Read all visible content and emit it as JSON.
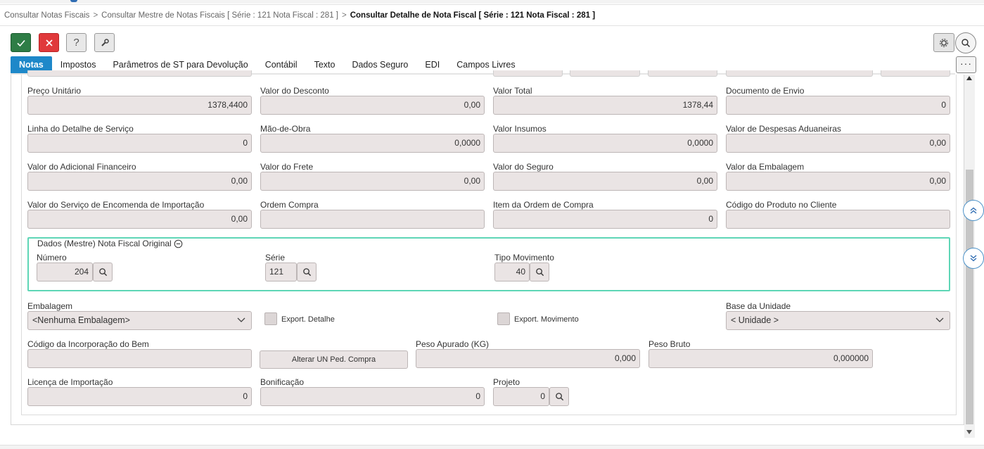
{
  "breadcrumb": {
    "item1": "Consultar Notas Fiscais",
    "separator": ">",
    "item2": "Consultar Mestre de Notas Fiscais [ Série : 121 Nota Fiscal : 281 ]",
    "current": "Consultar Detalhe de Nota Fiscal [ Série : 121 Nota Fiscal : 281 ]"
  },
  "toolbar": {
    "confirm_icon": "check-icon",
    "cancel_icon": "close-icon",
    "help_label": "?",
    "tool_icon": "wrench-icon",
    "gear_icon": "gear-icon",
    "search_icon": "search-icon",
    "more_label": "···"
  },
  "tabs": [
    {
      "label": "Notas",
      "active": true
    },
    {
      "label": "Impostos"
    },
    {
      "label": "Parâmetros de ST para Devolução"
    },
    {
      "label": "Contábil"
    },
    {
      "label": "Texto"
    },
    {
      "label": "Dados Seguro"
    },
    {
      "label": "EDI"
    },
    {
      "label": "Campos Livres"
    }
  ],
  "fields": {
    "preco_unitario": {
      "label": "Preço Unitário",
      "value": "1378,4400"
    },
    "valor_desconto": {
      "label": "Valor do Desconto",
      "value": "0,00"
    },
    "valor_total": {
      "label": "Valor Total",
      "value": "1378,44"
    },
    "documento_envio": {
      "label": "Documento de Envio",
      "value": "0"
    },
    "linha_detalhe_servico": {
      "label": "Linha do Detalhe de Serviço",
      "value": "0"
    },
    "mao_de_obra": {
      "label": "Mão-de-Obra",
      "value": "0,0000"
    },
    "valor_insumos": {
      "label": "Valor Insumos",
      "value": "0,0000"
    },
    "valor_despesas_aduaneiras": {
      "label": "Valor de Despesas Aduaneiras",
      "value": "0,00"
    },
    "valor_adicional_financeiro": {
      "label": "Valor do Adicional Financeiro",
      "value": "0,00"
    },
    "valor_frete": {
      "label": "Valor do Frete",
      "value": "0,00"
    },
    "valor_seguro": {
      "label": "Valor do Seguro",
      "value": "0,00"
    },
    "valor_embalagem": {
      "label": "Valor da Embalagem",
      "value": "0,00"
    },
    "valor_servico_encomenda": {
      "label": "Valor do Serviço de Encomenda de Importação",
      "value": "0,00"
    },
    "ordem_compra": {
      "label": "Ordem Compra",
      "value": ""
    },
    "item_ordem_compra": {
      "label": "Item da Ordem de Compra",
      "value": "0"
    },
    "codigo_produto_cliente": {
      "label": "Código do Produto no Cliente",
      "value": ""
    },
    "codigo_incorporacao_bem": {
      "label": "Código da Incorporação do Bem",
      "value": ""
    },
    "peso_apurado": {
      "label": "Peso Apurado (KG)",
      "value": "0,000"
    },
    "peso_bruto": {
      "label": "Peso Bruto",
      "value": "0,000000"
    },
    "licenca_importacao": {
      "label": "Licença de Importação",
      "value": "0"
    },
    "bonificacao": {
      "label": "Bonificação",
      "value": "0"
    },
    "projeto": {
      "label": "Projeto",
      "value": "0"
    }
  },
  "original_invoice": {
    "title": "Dados (Mestre) Nota Fiscal Original",
    "numero": {
      "label": "Número",
      "value": "204"
    },
    "serie": {
      "label": "Série",
      "value": "121"
    },
    "tipo_movimento": {
      "label": "Tipo Movimento",
      "value": "40"
    }
  },
  "embalagem": {
    "label": "Embalagem",
    "selected": "<Nenhuma Embalagem>"
  },
  "export_detalhe": {
    "label": "Export. Detalhe",
    "checked": false
  },
  "export_movimento": {
    "label": "Export. Movimento",
    "checked": false
  },
  "base_unidade": {
    "label": "Base da Unidade",
    "selected": "< Unidade >"
  },
  "alterar_un_button": "Alterar UN Ped. Compra",
  "colors": {
    "accent": "#1e88c9",
    "confirm": "#2e7d46",
    "cancel": "#e0393b",
    "group_border": "#5ed6b6",
    "field_bg": "#eae4e4"
  }
}
